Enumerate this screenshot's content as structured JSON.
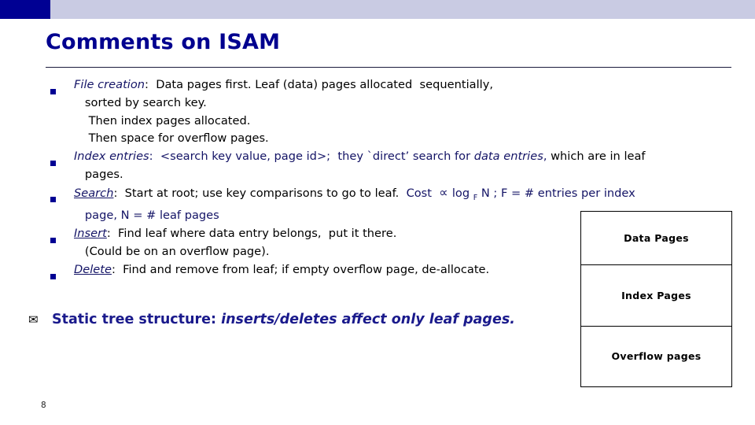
{
  "slide": {
    "title": "Comments on ISAM",
    "page_number": "8",
    "accent_color": "#000093",
    "band_color": "#c9cbe3",
    "navy_text_color": "#141466",
    "body_text_color": "#000000"
  },
  "bullets": [
    {
      "marker": "square-bullet",
      "segments": [
        {
          "text": "File creation",
          "style": "navy-italic"
        },
        {
          "text": ":  Data pages first. Leaf (data) pages allocated  sequentially,",
          "style": "plain"
        },
        {
          "text": "\n   sorted by search key.",
          "style": "plain"
        },
        {
          "text": "\n    Then index pages allocated.",
          "style": "plain"
        },
        {
          "text": "\n    Then space for overflow pages.",
          "style": "plain"
        }
      ]
    },
    {
      "marker": "square-bullet",
      "segments": [
        {
          "text": "Index entries",
          "style": "navy-italic"
        },
        {
          "text": ":  <search key value, page id>;  they `direct’ search for ",
          "style": "navy"
        },
        {
          "text": "data entries",
          "style": "navy-italic"
        },
        {
          "text": ", ",
          "style": "navy"
        },
        {
          "text": "which are in leaf\n   pages.",
          "style": "plain"
        }
      ]
    },
    {
      "marker": "square-bullet",
      "segments": [
        {
          "text": "Search",
          "style": "navy-italic-underline"
        },
        {
          "text": ":  Start at root; use key comparisons to go to leaf.  ",
          "style": "plain"
        },
        {
          "text": "Cost  ",
          "style": "navy"
        },
        {
          "text": "∝",
          "style": "navy-prop"
        },
        {
          "text": " log ",
          "style": "navy"
        },
        {
          "text": "F",
          "style": "navy-sub"
        },
        {
          "text": " N ; F = # entries per index\n   page, N = # leaf pages",
          "style": "navy"
        }
      ]
    },
    {
      "marker": "square-bullet",
      "segments": [
        {
          "text": "Insert",
          "style": "navy-italic-underline"
        },
        {
          "text": ":  Find leaf where data entry belongs,  put it there.\n   (Could be on an overflow page).",
          "style": "plain"
        }
      ]
    },
    {
      "marker": "square-bullet",
      "segments": [
        {
          "text": "Delete",
          "style": "navy-italic-underline"
        },
        {
          "text": ":  Find and remove from leaf; if empty overflow page, de-allocate.",
          "style": "plain"
        }
      ]
    }
  ],
  "static_structure": {
    "marker": "envelope-bullet",
    "marker_glyph": "✉",
    "label": "Static tree structure:  ",
    "emphasis": "inserts/deletes affect only leaf pages."
  },
  "diagram": {
    "cells": [
      {
        "label": "Data Pages"
      },
      {
        "label": "Index Pages"
      },
      {
        "label": "Overflow pages"
      }
    ]
  }
}
